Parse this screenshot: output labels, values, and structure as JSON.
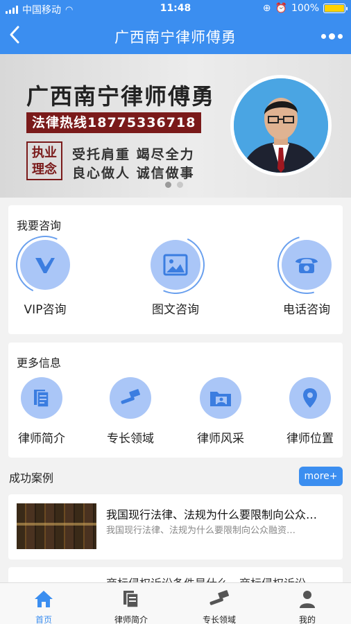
{
  "status": {
    "carrier": "中国移动",
    "time": "11:48",
    "battery": "100%"
  },
  "nav": {
    "back": "‹",
    "title": "广西南宁律师傅勇"
  },
  "banner": {
    "title": "广西南宁律师傅勇",
    "hotline": "法律热线18775336718",
    "seal_line1": "执业",
    "seal_line2": "理念",
    "motto1": "受托肩重  竭尽全力",
    "motto2": "良心做人  诚信做事"
  },
  "consult": {
    "title": "我要咨询",
    "items": [
      {
        "label": "VIP咨询",
        "icon": "vip-icon"
      },
      {
        "label": "图文咨询",
        "icon": "image-icon"
      },
      {
        "label": "电话咨询",
        "icon": "phone-icon"
      }
    ]
  },
  "more_info": {
    "title": "更多信息",
    "items": [
      {
        "label": "律师简介",
        "icon": "document-icon"
      },
      {
        "label": "专长领域",
        "icon": "gavel-icon"
      },
      {
        "label": "律师风采",
        "icon": "photo-folder-icon"
      },
      {
        "label": "律师位置",
        "icon": "location-pin-icon"
      }
    ]
  },
  "cases": {
    "title": "成功案例",
    "more_label": "more+",
    "items": [
      {
        "title": "我国现行法律、法规为什么要限制向公众…",
        "desc": "我国现行法律、法规为什么要限制向公众融资…"
      },
      {
        "title": "商标侵权诉讼条件是什么，商标侵权诉讼…",
        "desc": ""
      }
    ]
  },
  "tabbar": {
    "items": [
      {
        "label": "首页",
        "icon": "home-icon",
        "active": true
      },
      {
        "label": "律师简介",
        "icon": "document-icon"
      },
      {
        "label": "专长领域",
        "icon": "gavel-icon"
      },
      {
        "label": "我的",
        "icon": "user-icon"
      }
    ]
  },
  "colors": {
    "brand": "#3b8ef0",
    "icon_circle": "#aac6f7",
    "banner_accent": "#7a1a1a"
  }
}
